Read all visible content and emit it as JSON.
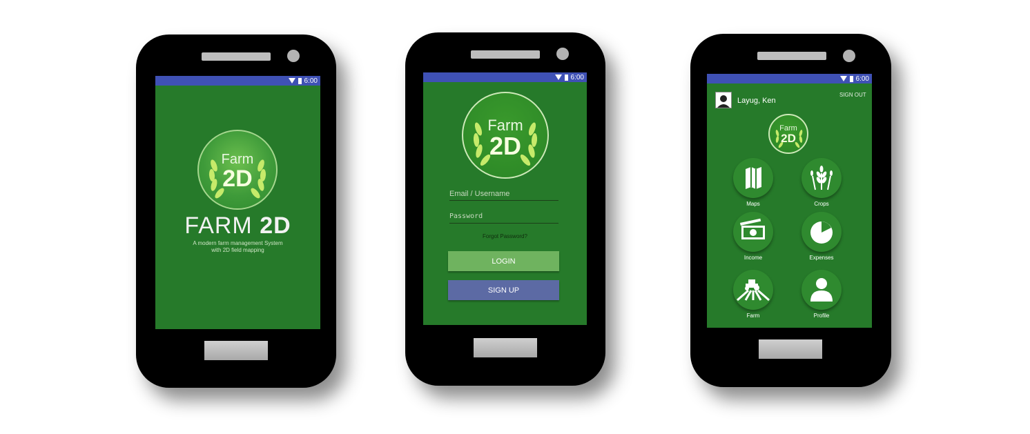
{
  "status_bar": {
    "time": "6:00"
  },
  "logo": {
    "farm": "Farm",
    "two_d": "2D"
  },
  "splash": {
    "title_light": "FARM ",
    "title_bold": "2D",
    "subtitle_1": "A modern farm management System",
    "subtitle_2": "with 2D field mapping"
  },
  "login": {
    "email_placeholder": "Email / Username",
    "password_placeholder": "Password",
    "forgot": "Forgot Password?",
    "login_label": "LOGIN",
    "signup_label": "SIGN UP"
  },
  "dashboard": {
    "user_name": "Layug, Ken",
    "sign_out": "SIGN OUT",
    "menu": [
      {
        "label": "Maps",
        "icon": "map-icon"
      },
      {
        "label": "Crops",
        "icon": "wheat-icon"
      },
      {
        "label": "Income",
        "icon": "cash-icon"
      },
      {
        "label": "Expenses",
        "icon": "pie-chart-icon"
      },
      {
        "label": "Farm",
        "icon": "tractor-field-icon"
      },
      {
        "label": "Profile",
        "icon": "person-icon"
      }
    ]
  },
  "colors": {
    "screen_green": "#267a2a",
    "status_bar": "#3f51b5",
    "login_button": "#6fb35f",
    "signup_button": "#5c6aa4"
  }
}
